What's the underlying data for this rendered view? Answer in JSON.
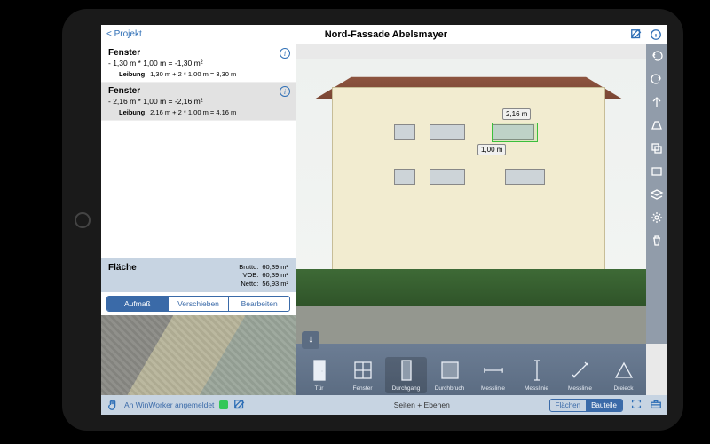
{
  "header": {
    "back": "< Projekt",
    "title": "Nord-Fassade Abelsmayer"
  },
  "items": [
    {
      "title": "Fenster",
      "calc": "- 1,30 m * 1,00 m = -1,30 m²",
      "sub_label": "Leibung",
      "sub_calc": "1,30 m + 2 * 1,00 m = 3,30 m",
      "selected": false
    },
    {
      "title": "Fenster",
      "calc": "- 2,16 m * 1,00 m = -2,16 m²",
      "sub_label": "Leibung",
      "sub_calc": "2,16 m + 2 * 1,00 m = 4,16 m",
      "selected": true
    }
  ],
  "summary": {
    "title": "Fläche",
    "rows": [
      {
        "label": "Brutto:",
        "value": "60,39 m²"
      },
      {
        "label": "VOB:",
        "value": "60,39 m²"
      },
      {
        "label": "Netto:",
        "value": "56,93 m²"
      }
    ]
  },
  "seg": {
    "a": "Aufmaß",
    "b": "Verschieben",
    "c": "Bearbeiten",
    "active": "a"
  },
  "measurements": {
    "width": "2,16 m",
    "height": "1,00 m"
  },
  "vtools": [
    "undo",
    "redo",
    "up-arrow",
    "perspective",
    "copy",
    "rect",
    "layers",
    "gear",
    "trash"
  ],
  "shapes": [
    {
      "label": "Tür",
      "kind": "door"
    },
    {
      "label": "Fenster",
      "kind": "window"
    },
    {
      "label": "Durchgang",
      "kind": "passage",
      "active": true
    },
    {
      "label": "Durchbruch",
      "kind": "opening"
    },
    {
      "label": "Messlinie",
      "kind": "hline"
    },
    {
      "label": "Messlinie",
      "kind": "vline"
    },
    {
      "label": "Messlinie",
      "kind": "diag"
    },
    {
      "label": "Dreieck",
      "kind": "tri"
    }
  ],
  "bottom": {
    "login": "An WinWorker angemeldet",
    "center": "Seiten + Ebenen",
    "seg": {
      "a": "Flächen",
      "b": "Bauteile",
      "active": "b"
    }
  }
}
